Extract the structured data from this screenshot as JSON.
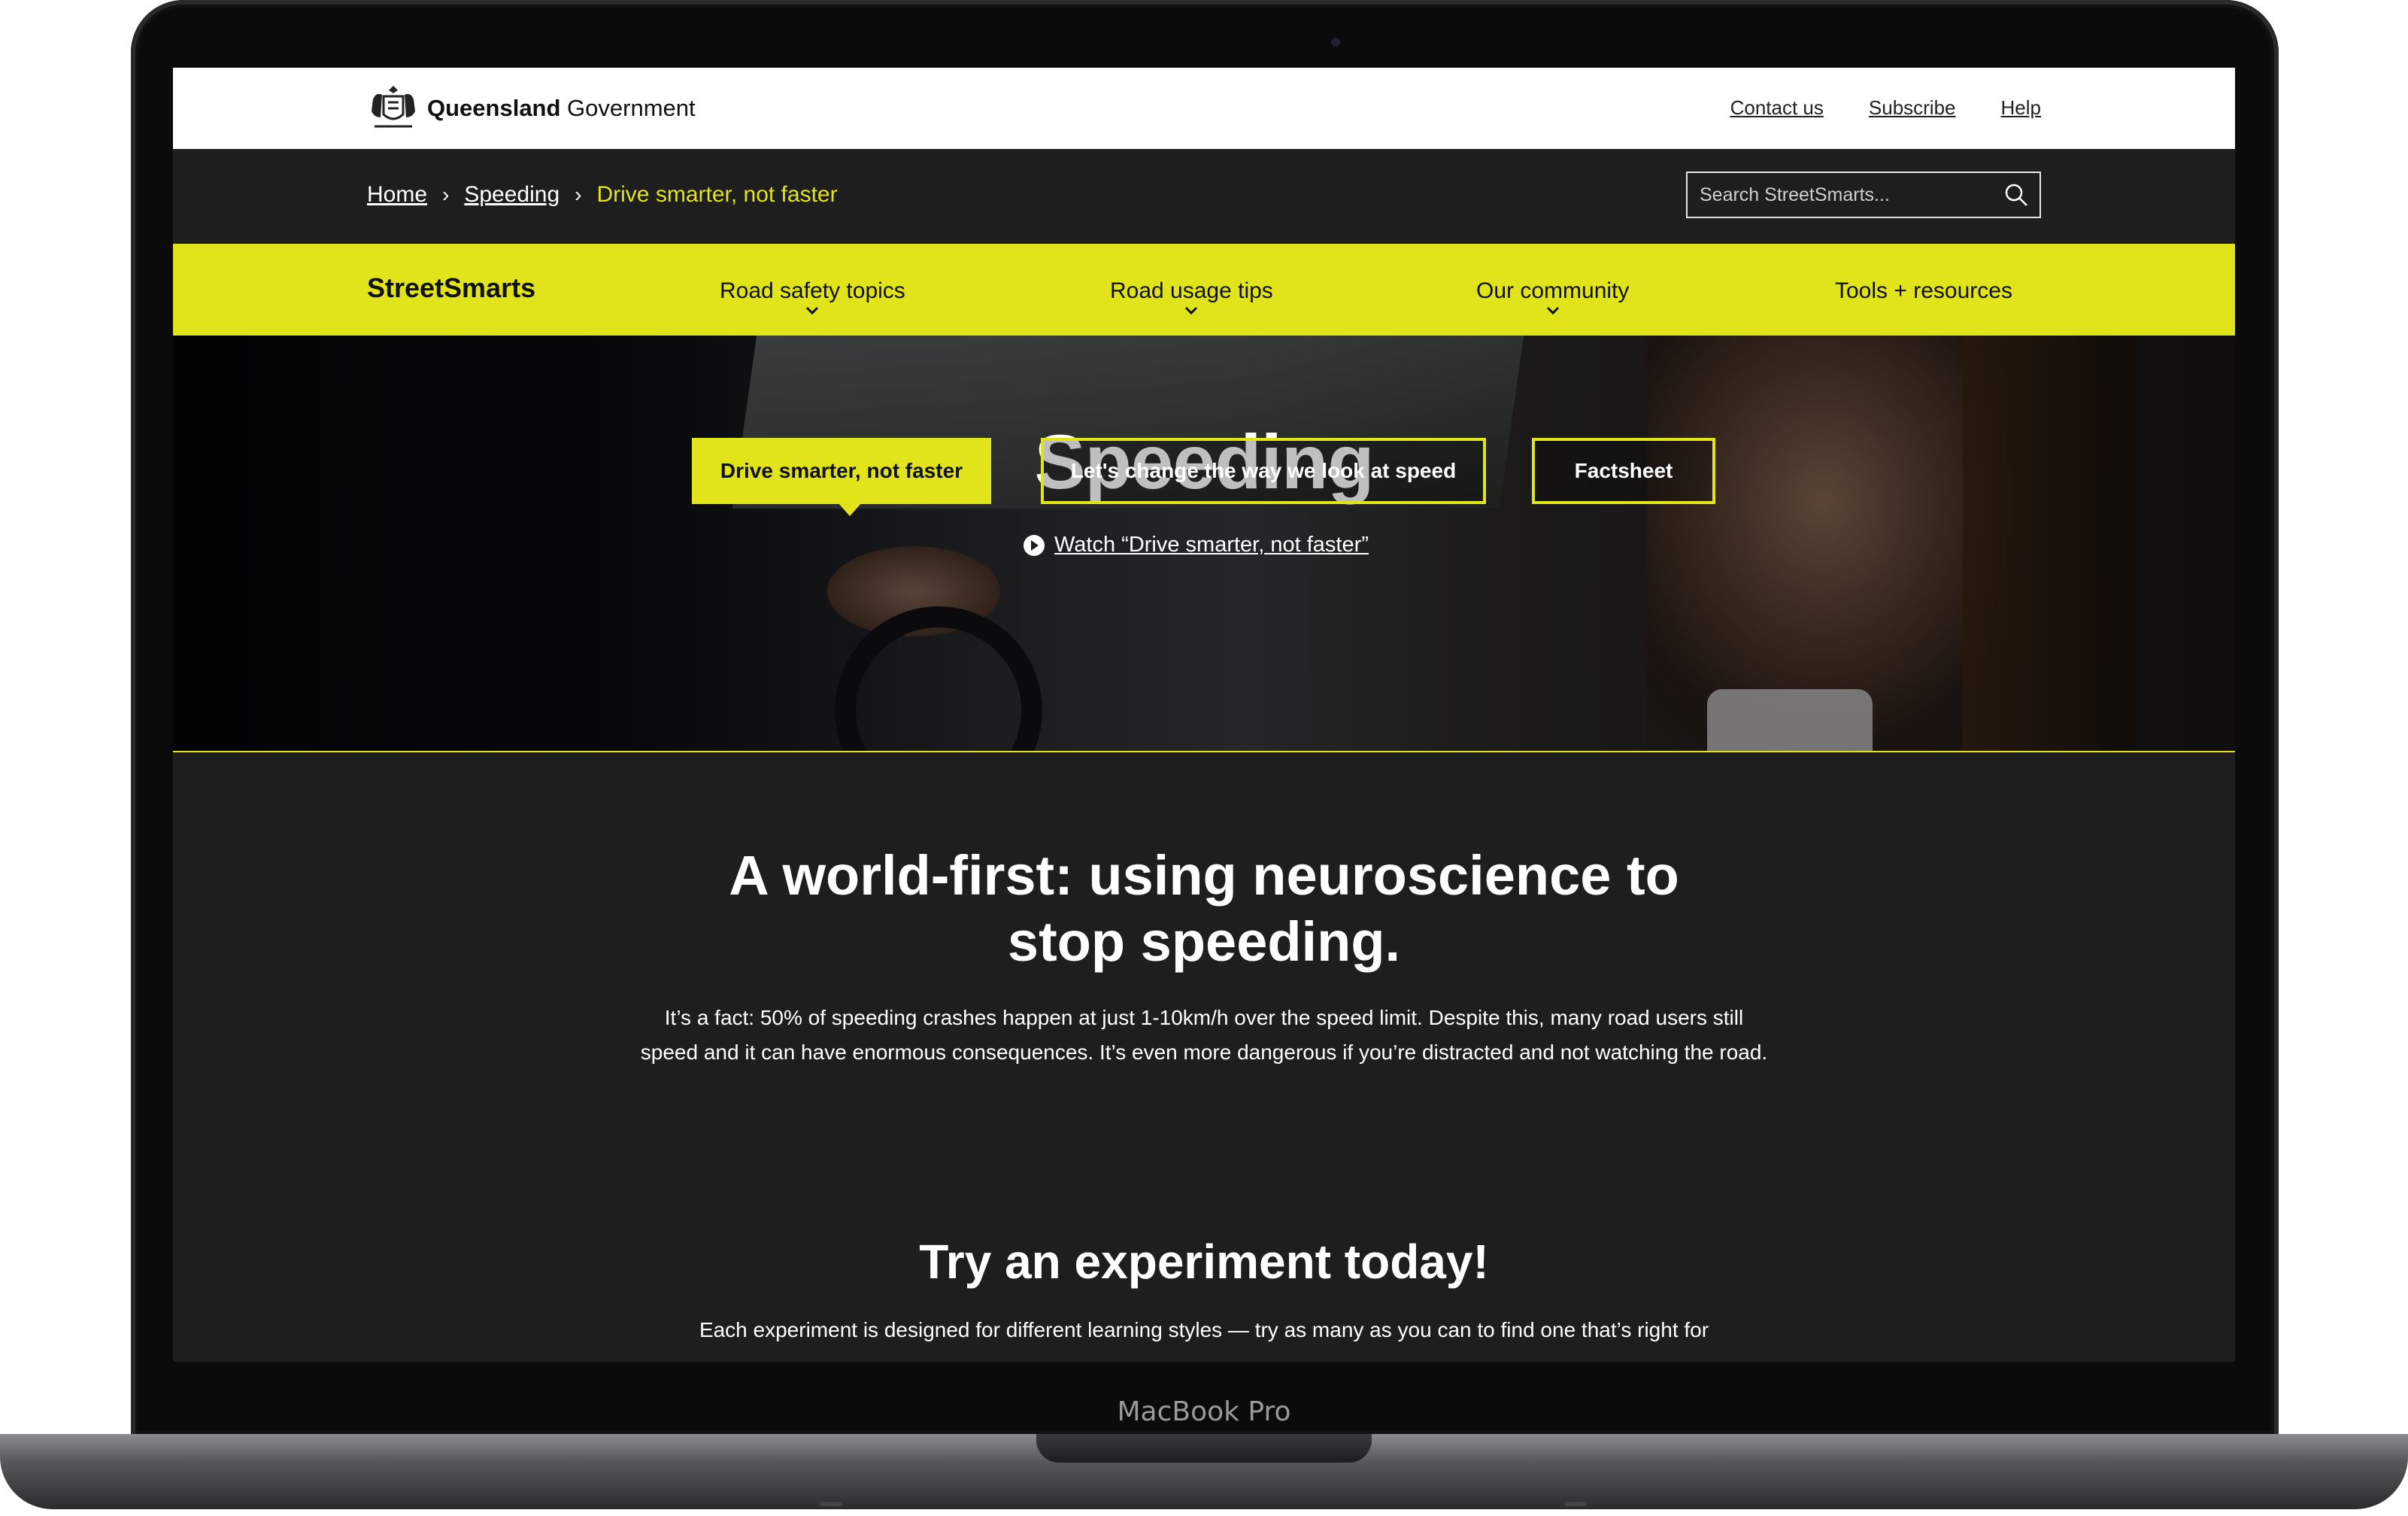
{
  "device": {
    "label": "MacBook Pro"
  },
  "header": {
    "logo_bold": "Queensland",
    "logo_regular": " Government",
    "links": [
      "Contact us",
      "Subscribe",
      "Help"
    ]
  },
  "breadcrumb": {
    "items": [
      "Home",
      "Speeding"
    ],
    "current": "Drive smarter, not faster"
  },
  "search": {
    "placeholder": "Search StreetSmarts..."
  },
  "nav": {
    "brand": "StreetSmarts",
    "items": [
      {
        "label": "Road safety topics"
      },
      {
        "label": "Road usage tips"
      },
      {
        "label": "Our community"
      },
      {
        "label": "Tools + resources"
      }
    ]
  },
  "hero": {
    "title": "Speeding",
    "watch_link": "Watch “Drive smarter, not faster”",
    "buttons": [
      "Drive smarter, not faster",
      "Let's change the way we look at speed",
      "Factsheet"
    ]
  },
  "content": {
    "heading": "A world-first: using neuroscience to stop speeding.",
    "paragraph": "It’s a fact: 50% of speeding crashes happen at just 1-10km/h over the speed limit. Despite this, many road users still speed and it can have enormous consequences. It’s even more dangerous if you’re distracted and not watching the road.",
    "subheading": "Try an experiment today!",
    "subparagraph": "Each experiment is designed for different learning styles — try as many as you can to find one that’s right for"
  },
  "colors": {
    "accent": "#e1e41b",
    "dark": "#1e1e1e"
  }
}
